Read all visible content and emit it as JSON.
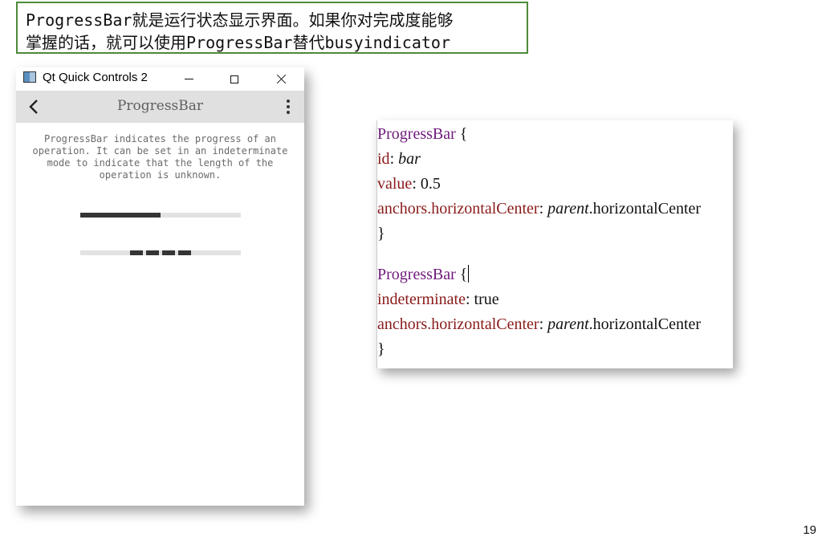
{
  "callout": {
    "line1": "ProgressBar就是运行状态显示界面。如果你对完成度能够",
    "line2": "掌握的话，就可以使用ProgressBar替代busyindicator",
    "border_color": "#4f8a3a"
  },
  "window": {
    "title": "Qt Quick Controls 2",
    "app_icon": "qt-window-icon",
    "controls": [
      "minimize-icon",
      "maximize-icon",
      "close-icon"
    ]
  },
  "toolbar": {
    "back_icon": "chevron-left-icon",
    "title": "ProgressBar",
    "menu_icon": "kebab-menu-icon",
    "background": "#e0e0e0"
  },
  "content": {
    "description": "ProgressBar indicates the progress of an operation. It can be set in an indeterminate mode to indicate that the length of the operation is unknown.",
    "progress_bar": {
      "value": 0.5
    },
    "indeterminate_bar": {
      "indeterminate": true,
      "dash_count": 4
    }
  },
  "code": {
    "block1": {
      "type": "ProgressBar",
      "open": " {",
      "id_key": "id",
      "id_value": "bar",
      "value_key": "value",
      "value_value": "0.5",
      "anchor_key": "anchors.horizontalCenter",
      "anchor_obj": "parent",
      "anchor_prop": ".horizontalCenter",
      "close": "}"
    },
    "block2": {
      "type": "ProgressBar",
      "open": " {",
      "indeterminate_key": "indeterminate",
      "indeterminate_value": "true",
      "anchor_key": "anchors.horizontalCenter",
      "anchor_obj": "parent",
      "anchor_prop": ".horizontalCenter",
      "close": "}"
    },
    "colors": {
      "type": "#6e1a7a",
      "property": "#8a1a1a"
    }
  },
  "page_number": "19"
}
